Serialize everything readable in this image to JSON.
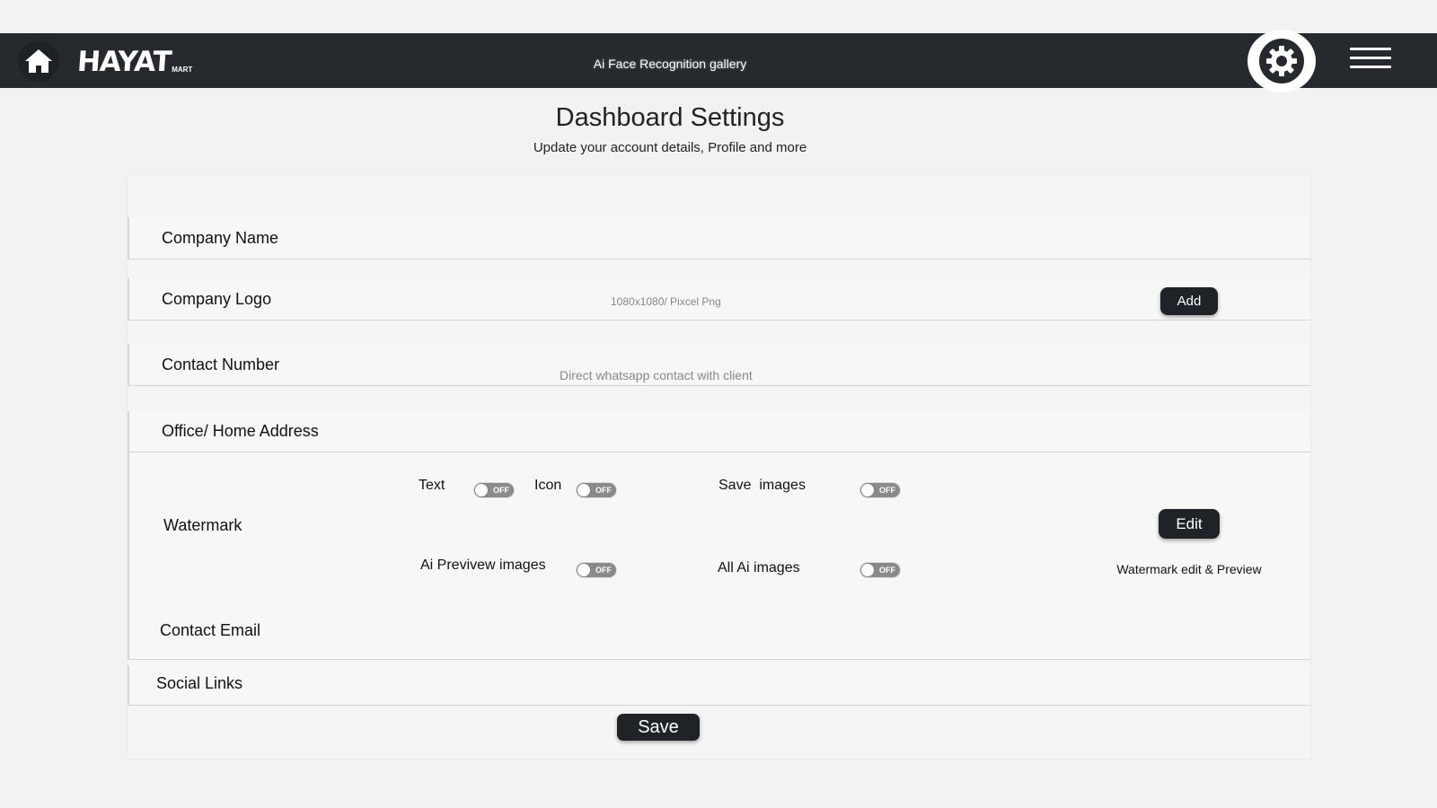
{
  "colors": {
    "topbar_bg": "#262a2e",
    "page_bg": "#f2f2f2",
    "button_bg": "#1f2327",
    "toggle_off": "#8a8a8a"
  },
  "header": {
    "home_icon": "home-icon",
    "logo_text": "HAYAT",
    "logo_subtext": "MART",
    "app_title": "Ai Face Recognition gallery",
    "settings_icon": "gear-icon",
    "menu_icon": "hamburger-menu-icon"
  },
  "page": {
    "title": "Dashboard Settings",
    "subtitle": "Update your account details, Profile and more"
  },
  "form": {
    "company_name": {
      "label": "Company Name"
    },
    "company_logo": {
      "label": "Company Logo",
      "hint": "1080x1080/ Pixcel Png",
      "add_label": "Add"
    },
    "contact_number": {
      "label": "Contact Number",
      "hint": "Direct whatsapp contact with client"
    },
    "address": {
      "label": "Office/ Home Address"
    },
    "watermark": {
      "label": "Watermark",
      "options": [
        {
          "label": "Text",
          "state": "OFF"
        },
        {
          "label": "Icon",
          "state": "OFF"
        },
        {
          "label": "Save  images",
          "state": "OFF"
        },
        {
          "label": "Ai Previvew images",
          "state": "OFF"
        },
        {
          "label": "All Ai images",
          "state": "OFF"
        }
      ],
      "edit_label": "Edit",
      "edit_caption": "Watermark edit & Preview"
    },
    "contact_email": {
      "label": "Contact Email"
    },
    "social_links": {
      "label": "Social Links"
    },
    "save_label": "Save"
  }
}
